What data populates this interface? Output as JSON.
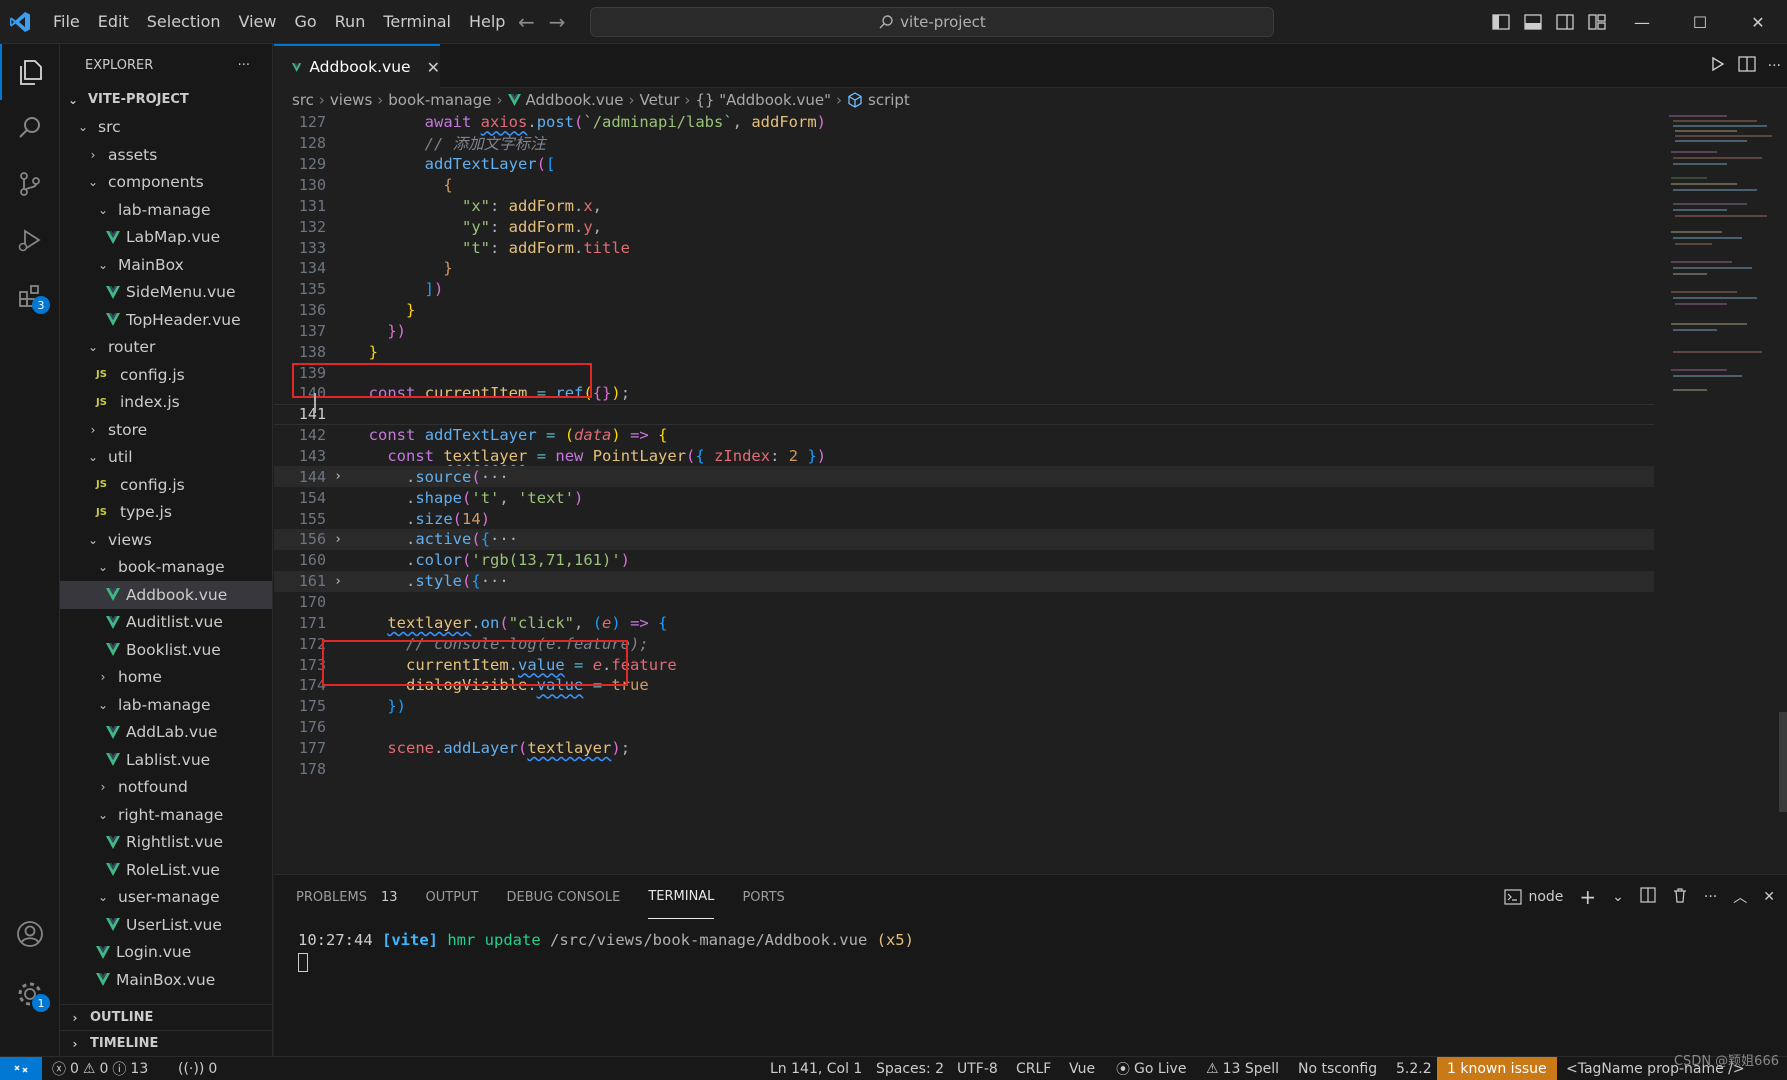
{
  "titlebar": {
    "menu": [
      "File",
      "Edit",
      "Selection",
      "View",
      "Go",
      "Run",
      "Terminal",
      "Help"
    ],
    "search_text": "vite-project"
  },
  "activity": {
    "extensions_badge": "3",
    "settings_badge": "1"
  },
  "sidebar": {
    "title": "EXPLORER",
    "more": "···",
    "project": "VITE-PROJECT",
    "tree": [
      {
        "label": "src",
        "depth": 1,
        "kind": "folder-open"
      },
      {
        "label": "assets",
        "depth": 2,
        "kind": "folder"
      },
      {
        "label": "components",
        "depth": 2,
        "kind": "folder-open"
      },
      {
        "label": "lab-manage",
        "depth": 3,
        "kind": "folder-open"
      },
      {
        "label": "LabMap.vue",
        "depth": 4,
        "kind": "vue"
      },
      {
        "label": "MainBox",
        "depth": 3,
        "kind": "folder-open"
      },
      {
        "label": "SideMenu.vue",
        "depth": 4,
        "kind": "vue"
      },
      {
        "label": "TopHeader.vue",
        "depth": 4,
        "kind": "vue"
      },
      {
        "label": "router",
        "depth": 2,
        "kind": "folder-open"
      },
      {
        "label": "config.js",
        "depth": 3,
        "kind": "js"
      },
      {
        "label": "index.js",
        "depth": 3,
        "kind": "js"
      },
      {
        "label": "store",
        "depth": 2,
        "kind": "folder"
      },
      {
        "label": "util",
        "depth": 2,
        "kind": "folder-open"
      },
      {
        "label": "config.js",
        "depth": 3,
        "kind": "js"
      },
      {
        "label": "type.js",
        "depth": 3,
        "kind": "js"
      },
      {
        "label": "views",
        "depth": 2,
        "kind": "folder-open"
      },
      {
        "label": "book-manage",
        "depth": 3,
        "kind": "folder-open"
      },
      {
        "label": "Addbook.vue",
        "depth": 4,
        "kind": "vue",
        "selected": true
      },
      {
        "label": "Auditlist.vue",
        "depth": 4,
        "kind": "vue"
      },
      {
        "label": "Booklist.vue",
        "depth": 4,
        "kind": "vue"
      },
      {
        "label": "home",
        "depth": 3,
        "kind": "folder"
      },
      {
        "label": "lab-manage",
        "depth": 3,
        "kind": "folder-open"
      },
      {
        "label": "AddLab.vue",
        "depth": 4,
        "kind": "vue"
      },
      {
        "label": "Lablist.vue",
        "depth": 4,
        "kind": "vue"
      },
      {
        "label": "notfound",
        "depth": 3,
        "kind": "folder"
      },
      {
        "label": "right-manage",
        "depth": 3,
        "kind": "folder-open"
      },
      {
        "label": "Rightlist.vue",
        "depth": 4,
        "kind": "vue"
      },
      {
        "label": "RoleList.vue",
        "depth": 4,
        "kind": "vue"
      },
      {
        "label": "user-manage",
        "depth": 3,
        "kind": "folder-open"
      },
      {
        "label": "UserList.vue",
        "depth": 4,
        "kind": "vue"
      },
      {
        "label": "Login.vue",
        "depth": 3,
        "kind": "vue"
      },
      {
        "label": "MainBox.vue",
        "depth": 3,
        "kind": "vue"
      }
    ],
    "outline": "OUTLINE",
    "timeline": "TIMELINE"
  },
  "tab": {
    "label": "Addbook.vue",
    "close": "✕"
  },
  "breadcrumbs": [
    "src",
    "views",
    "book-manage",
    "Addbook.vue",
    "Vetur",
    "{} \"Addbook.vue\"",
    "script"
  ],
  "editor": {
    "lines": [
      {
        "n": "127",
        "fold": "",
        "html": "        <span class='pur'>await</span> <span class='red squig'>axios</span><span class='wht'>.</span><span class='blu'>post</span><span class='brk2'>(</span><span class='grn'>`/adminapi/labs`</span><span class='wht'>, </span><span class='yel'>addForm</span><span class='brk2'>)</span>"
      },
      {
        "n": "128",
        "fold": "",
        "html": "        <span class='gry'>// 添加文字标注</span>"
      },
      {
        "n": "129",
        "fold": "",
        "html": "        <span class='blu'>addTextLayer</span><span class='brk2'>(</span><span class='brk3'>[</span>"
      },
      {
        "n": "130",
        "fold": "",
        "html": "          <span class='org'>{</span>"
      },
      {
        "n": "131",
        "fold": "",
        "html": "            <span class='grn'>\"x\"</span><span class='wht'>: </span><span class='yel'>addForm</span><span class='wht'>.</span><span class='red'>x</span><span class='wht'>,</span>"
      },
      {
        "n": "132",
        "fold": "",
        "html": "            <span class='grn'>\"y\"</span><span class='wht'>: </span><span class='yel'>addForm</span><span class='wht'>.</span><span class='red'>y</span><span class='wht'>,</span>"
      },
      {
        "n": "133",
        "fold": "",
        "html": "            <span class='grn'>\"t\"</span><span class='wht'>: </span><span class='yel'>addForm</span><span class='wht'>.</span><span class='red'>title</span>"
      },
      {
        "n": "134",
        "fold": "",
        "html": "          <span class='org'>}</span>"
      },
      {
        "n": "135",
        "fold": "",
        "html": "        <span class='brk3'>]</span><span class='brk2'>)</span>"
      },
      {
        "n": "136",
        "fold": "",
        "html": "      <span class='brk1'>}</span>"
      },
      {
        "n": "137",
        "fold": "",
        "html": "    <span class='brk2'>})</span>"
      },
      {
        "n": "138",
        "fold": "",
        "html": "  <span class='brk1'>}</span>"
      },
      {
        "n": "139",
        "fold": "",
        "html": ""
      },
      {
        "n": "140",
        "fold": "",
        "html": "  <span class='pur'>const</span> <span class='yel'>currentItem</span> <span class='cyn'>=</span> <span class='blu'>ref</span><span class='brk1'>(</span><span class='brk2'>{}</span><span class='brk1'>)</span><span class='wht'>;</span>"
      },
      {
        "n": "141",
        "fold": "",
        "html": "",
        "current": true
      },
      {
        "n": "142",
        "fold": "",
        "html": "  <span class='pur'>const</span> <span class='blu'>addTextLayer</span> <span class='cyn'>=</span> <span class='brk1'>(</span><span class='red'><i>data</i></span><span class='brk1'>)</span> <span class='pur'>=&gt;</span> <span class='brk1'>{</span>"
      },
      {
        "n": "143",
        "fold": "",
        "html": "    <span class='pur'>const</span> <span class='yel squig'>textlayer</span> <span class='cyn'>=</span> <span class='pur'>new</span> <span class='yel'>PointLayer</span><span class='brk2'>(</span><span class='brk3'>{</span> <span class='red'>zIndex</span><span class='wht'>: </span><span class='org'>2</span> <span class='brk3'>}</span><span class='brk2'>)</span>"
      },
      {
        "n": "144",
        "fold": "›",
        "html": "      <span class='wht'>.</span><span class='blu'>source</span><span class='brk2'>(</span><span class='wht'>···</span>",
        "folded": true
      },
      {
        "n": "154",
        "fold": "",
        "html": "      <span class='wht'>.</span><span class='blu'>shape</span><span class='brk2'>(</span><span class='grn'>'t'</span><span class='wht'>, </span><span class='grn'>'text'</span><span class='brk2'>)</span>"
      },
      {
        "n": "155",
        "fold": "",
        "html": "      <span class='wht'>.</span><span class='blu'>size</span><span class='brk2'>(</span><span class='org'>14</span><span class='brk2'>)</span>"
      },
      {
        "n": "156",
        "fold": "›",
        "html": "      <span class='wht'>.</span><span class='blu'>active</span><span class='brk2'>(</span><span class='brk3'>{</span><span class='wht'>···</span>",
        "folded": true
      },
      {
        "n": "160",
        "fold": "",
        "html": "      <span class='wht'>.</span><span class='blu'>color</span><span class='brk2'>(</span><span class='grn'>'rgb(13,71,161)'</span><span class='brk2'>)</span>"
      },
      {
        "n": "161",
        "fold": "›",
        "html": "      <span class='wht'>.</span><span class='blu'>style</span><span class='brk2'>(</span><span class='brk3'>{</span><span class='wht'>···</span>",
        "folded": true
      },
      {
        "n": "170",
        "fold": "",
        "html": ""
      },
      {
        "n": "171",
        "fold": "",
        "html": "    <span class='yel squig'>textlayer</span><span class='wht'>.</span><span class='blu'>on</span><span class='brk2'>(</span><span class='grn'>\"click\"</span><span class='wht'>, </span><span class='brk3'>(</span><span class='red'><i>e</i></span><span class='brk3'>)</span> <span class='pur'>=&gt;</span> <span class='brk3'>{</span>"
      },
      {
        "n": "172",
        "fold": "",
        "html": "      <span class='gry'>// console.log(e.feature);</span>"
      },
      {
        "n": "173",
        "fold": "",
        "html": "      <span class='yel'>currentItem</span><span class='wht'>.</span><span class='blu squig'>value</span> <span class='cyn'>=</span> <span class='red'><i>e</i></span><span class='wht'>.</span><span class='red'>feature</span>"
      },
      {
        "n": "174",
        "fold": "",
        "html": "      <span class='yel'>dialogVisible</span><span class='wht'>.</span><span class='blu squig'>value</span> <span class='cyn'>=</span> <span class='org'>true</span>"
      },
      {
        "n": "175",
        "fold": "",
        "html": "    <span class='brk3'>})</span>"
      },
      {
        "n": "176",
        "fold": "",
        "html": ""
      },
      {
        "n": "177",
        "fold": "",
        "html": "    <span class='red'>scene</span><span class='wht'>.</span><span class='blu'>addLayer</span><span class='brk2'>(</span><span class='yel squig'>textlayer</span><span class='brk2'>)</span><span class='wht'>;</span>"
      },
      {
        "n": "178",
        "fold": "",
        "html": ""
      }
    ]
  },
  "panel": {
    "tabs": [
      {
        "label": "PROBLEMS",
        "badge": "13"
      },
      {
        "label": "OUTPUT",
        "badge": ""
      },
      {
        "label": "DEBUG CONSOLE",
        "badge": ""
      },
      {
        "label": "TERMINAL",
        "badge": "",
        "active": true
      },
      {
        "label": "PORTS",
        "badge": ""
      }
    ],
    "terminal_name": "node",
    "terminal_time": "10:27:44",
    "terminal_tag": "[vite]",
    "terminal_msg": "hmr update",
    "terminal_path": "/src/views/book-manage/Addbook.vue",
    "terminal_count": "(x5)"
  },
  "status": {
    "errors": "0",
    "warnings": "0",
    "info": "13",
    "ports": "0",
    "position": "Ln 141, Col 1",
    "spaces": "Spaces: 2",
    "encoding": "UTF-8",
    "eol": "CRLF",
    "language": "Vue",
    "golive": "Go Live",
    "spell": "13 Spell",
    "tsconfig": "No tsconfig",
    "version": "5.2.2",
    "issue": "1 known issue",
    "tagname": "<TagName prop-name />",
    "watermark": "CSDN @颖姐666"
  },
  "colors": {
    "accent": "#0078d4",
    "issue_bg": "#c97a17",
    "annotation_red": "#e02828"
  }
}
